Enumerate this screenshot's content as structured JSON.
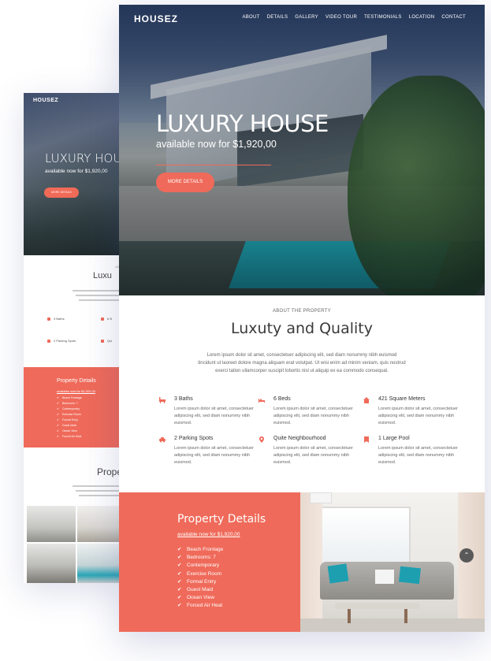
{
  "back": {
    "logo": "HOUSEZ",
    "hero_title": "LUXURY HOUS",
    "hero_sub": "available now for $1,920,00",
    "hero_button": "MORE DETAILS",
    "about_label": "ABO",
    "about_title": "Luxu",
    "features": [
      "3 Baths",
      "6 B",
      "2 Parking Spots",
      "Qui"
    ],
    "details_title": "Property Details",
    "details_price": "available now for $1,920,00",
    "details_items": [
      "Beach Frontage",
      "Bedrooms: 7",
      "Contemporary",
      "Exercise Room",
      "Formal Entry",
      "Guest Maid",
      "Ocean View",
      "Forced Air Heat"
    ],
    "props_title": "Prope"
  },
  "front": {
    "logo": "HOUSEZ",
    "nav": [
      "ABOUT",
      "DETAILS",
      "GALLERY",
      "VIDEO TOUR",
      "TESTIMONIALS",
      "LOCATION",
      "CONTACT"
    ],
    "hero_title": "LUXURY HOUSE",
    "hero_sub": "available now for $1,920,00",
    "hero_button": "MORE DETAILS",
    "about_label": "ABOUT THE PROPERTY",
    "about_title": "Luxuty and Quality",
    "about_text": "Lorem ipsum dolor sit amet, consectetuer adipiscing elit, sed diam nonummy nibh euismod tincidunt ut laoreet dolore magna aliquam erat volutpat. Ut wisi enim ad minim veniam, quis nostrud exerci tation ullamcorper suscipit lobortis nisl ut aliquip ex ea commodo consequat.",
    "features": [
      {
        "title": "3 Baths",
        "icon": "bath-icon",
        "text": "Lorem ipsum dolor sit amet, consectetuer adipiscing elit, sed diam nonummy nibh euismod."
      },
      {
        "title": "6 Beds",
        "icon": "bed-icon",
        "text": "Lorem ipsum dolor sit amet, consectetuer adipiscing elit, sed diam nonummy nibh euismod."
      },
      {
        "title": "421 Square Meters",
        "icon": "home-icon",
        "text": "Lorem ipsum dolor sit amet, consectetuer adipiscing elit, sed diam nonummy nibh euismod."
      },
      {
        "title": "2 Parking Spots",
        "icon": "car-icon",
        "text": "Lorem ipsum dolor sit amet, consectetuer adipiscing elit, sed diam nonummy nibh euismod."
      },
      {
        "title": "Quite Neighbourhood",
        "icon": "map-pin-icon",
        "text": "Lorem ipsum dolor sit amet, consectetuer adipiscing elit, sed diam nonummy nibh euismod."
      },
      {
        "title": "1 Large Pool",
        "icon": "bookmark-icon",
        "text": "Lorem ipsum dolor sit amet, consectetuer adipiscing elit, sed diam nonummy nibh euismod."
      }
    ],
    "details_title": "Property Details",
    "details_price": "available now for $1,920,00",
    "details_items": [
      "Beach Frontage",
      "Bedrooms: 7",
      "Contemporary",
      "Exercise Room",
      "Formal Entry",
      "Guest Maid",
      "Ocean View",
      "Forced Air Heat"
    ],
    "scroll_top_icon": "chevron-up-icon"
  },
  "colors": {
    "accent": "#ef6a5a",
    "text_dark": "#3a3a3a",
    "text_muted": "#666666"
  }
}
